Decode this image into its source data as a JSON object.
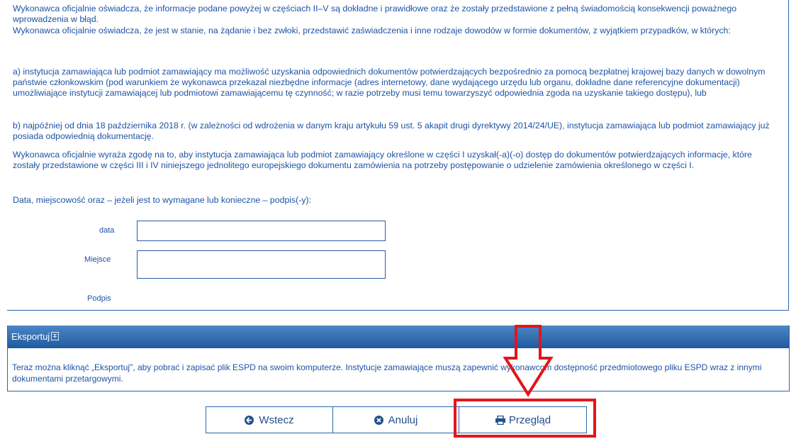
{
  "declaration": {
    "para1": "Wykonawca oficjalnie oświadcza, że informacje podane powyżej w częściach II–V są dokładne i prawidłowe oraz że zostały przedstawione z pełną świadomością konsekwencji poważnego wprowadzenia w błąd.",
    "para2": "Wykonawca oficjalnie oświadcza, że jest w stanie, na żądanie i bez zwłoki, przedstawić zaświadczenia i inne rodzaje dowodów w formie dokumentów, z wyjątkiem przypadków, w których:",
    "para3": "a) instytucja zamawiająca lub podmiot zamawiający ma możliwość uzyskania odpowiednich dokumentów potwierdzających bezpośrednio za pomocą bezpłatnej krajowej bazy danych w dowolnym państwie członkowskim (pod warunkiem że wykonawca przekazał niezbędne informacje (adres internetowy, dane wydającego urzędu lub organu, dokładne dane referencyjne dokumentacji) umożliwiające instytucji zamawiającej lub podmiotowi zamawiającemu tę czynność; w razie potrzeby musi temu towarzyszyć odpowiednia zgoda na uzyskanie takiego dostępu), lub",
    "para4": "b) najpóźniej od dnia 18 października 2018 r. (w zależności od wdrożenia w danym kraju artykułu 59 ust. 5 akapit drugi dyrektywy 2014/24/UE), instytucja zamawiająca lub podmiot zamawiający już posiada odpowiednią dokumentację.",
    "para5": "Wykonawca oficjalnie wyraża zgodę na to, aby instytucja zamawiająca lub podmiot zamawiający określone w części I uzyskał(-a)(-o) dostęp do dokumentów potwierdzających informacje, które zostały przedstawione w części III i IV niniejszego jednolitego europejskiego dokumentu zamówienia na potrzeby postępowanie o udzielenie zamówienia określonego w części I.",
    "signature_intro": "Data, miejscowość oraz – jeżeli jest to wymagane lub konieczne – podpis(-y):"
  },
  "form": {
    "date_label": "data",
    "date_value": "",
    "place_label": "Miejsce",
    "place_value": "",
    "signature_label": "Podpis"
  },
  "export": {
    "title": "Eksportuj",
    "description": "Teraz można kliknąć „Eksportuj\", aby pobrać i zapisać plik ESPD na swoim komputerze. Instytucje zamawiające muszą zapewnić wykonawcom dostępność przedmiotowego pliku ESPD wraz z innymi dokumentami przetargowymi."
  },
  "buttons": {
    "back": "Wstecz",
    "cancel": "Anuluj",
    "preview": "Przegląd"
  },
  "icons": {
    "export_title": "help-icon",
    "back": "arrow-circle-left-icon",
    "cancel": "times-circle-icon",
    "preview": "print-icon"
  },
  "colors": {
    "text": "#1d53a6",
    "border": "#2a66a8",
    "header_top": "#4d86c6",
    "header_bottom": "#1f5a9e",
    "annotation": "#e3151b"
  }
}
